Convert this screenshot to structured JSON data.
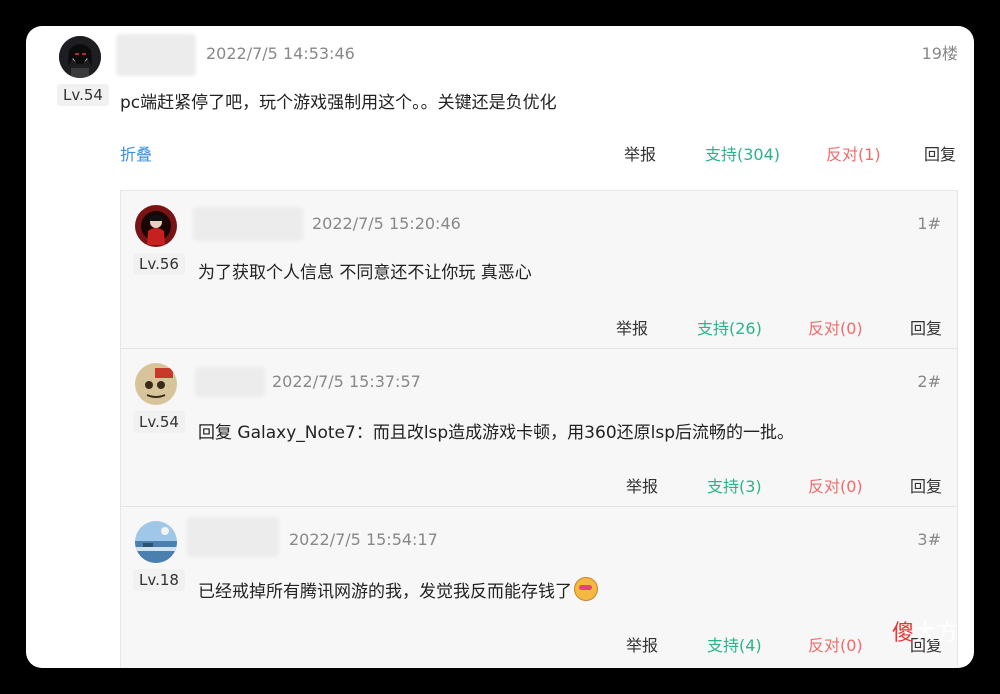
{
  "main": {
    "level": "Lv.54",
    "time": "2022/7/5 14:53:46",
    "floor": "19楼",
    "text": "pc端赶紧停了吧，玩个游戏强制用这个。。关键还是负优化",
    "fold": "折叠",
    "report": "举报",
    "support": "支持(304)",
    "oppose": "反对(1)",
    "reply": "回复"
  },
  "replies": [
    {
      "level": "Lv.56",
      "time": "2022/7/5 15:20:46",
      "floor": "1#",
      "text": "为了获取个人信息 不同意还不让你玩 真恶心",
      "report": "举报",
      "support": "支持(26)",
      "oppose": "反对(0)",
      "reply": "回复"
    },
    {
      "level": "Lv.54",
      "time": "2022/7/5 15:37:57",
      "floor": "2#",
      "text": "回复 Galaxy_Note7：而且改lsp造成游戏卡顿，用360还原lsp后流畅的一批。",
      "report": "举报",
      "support": "支持(3)",
      "oppose": "反对(0)",
      "reply": "回复"
    },
    {
      "level": "Lv.18",
      "time": "2022/7/5 15:54:17",
      "floor": "3#",
      "text": "已经戒掉所有腾讯网游的我，发觉我反而能存钱了",
      "report": "举报",
      "support": "支持(4)",
      "oppose": "反对(0)",
      "reply": "回复"
    }
  ],
  "watermark": {
    "first": "傻",
    "rest": "大方"
  },
  "colors": {
    "support": "#2bb38a",
    "oppose": "#f26b6b",
    "fold": "#3a8ee6"
  }
}
